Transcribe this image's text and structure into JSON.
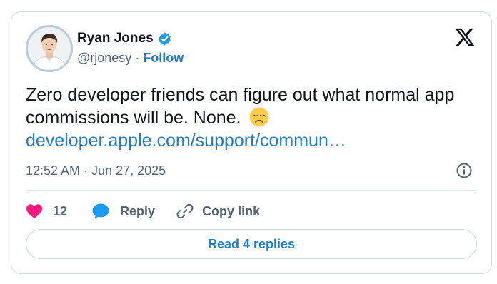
{
  "author": {
    "name": "Ryan Jones",
    "handle": "@rjonesy",
    "separator": "·",
    "follow_label": "Follow",
    "verified_icon": "verified-badge-icon",
    "verified_color": "#1d9bf0"
  },
  "tweet": {
    "text": "Zero developer friends can figure out what normal app commissions will be. None.",
    "emoji_icon": "disappointed-face-emoji",
    "link_text": "developer.apple.com/support/commun…",
    "timestamp": "12:52 AM · Jun 27, 2025"
  },
  "actions": {
    "like_count": "12",
    "reply_label": "Reply",
    "copy_link_label": "Copy link",
    "like_color": "#f91880",
    "reply_color": "#1d9bf0"
  },
  "read_replies_label": "Read 4 replies",
  "colors": {
    "accent": "#1d7bd1",
    "secondary_text": "#536471",
    "border": "#cfd9de"
  }
}
